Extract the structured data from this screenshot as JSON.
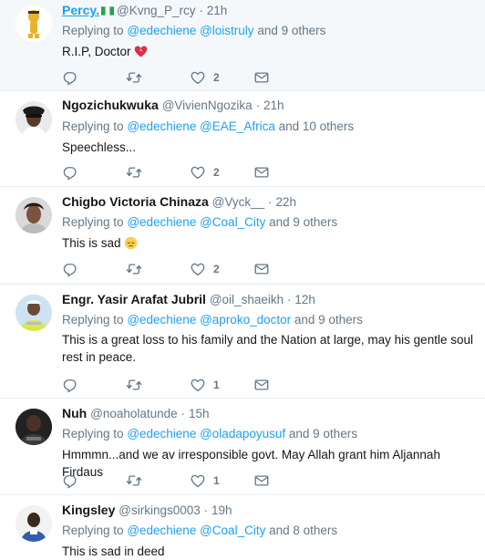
{
  "tweets": [
    {
      "name": "Percy.",
      "handle": "@Kvng_P_rcy",
      "separator": "·",
      "time": "21h",
      "replying_to_label": "Replying to",
      "mentions": [
        "@edechiene",
        "@loistruly"
      ],
      "others": "and 9 others",
      "text": "R.I.P, Doctor",
      "like_count": "2",
      "flag": "nigeria-flag",
      "emoji": "broken-heart"
    },
    {
      "name": "Ngozichukwuka",
      "handle": "@VivienNgozika",
      "separator": "·",
      "time": "21h",
      "replying_to_label": "Replying to",
      "mentions": [
        "@edechiene",
        "@EAE_Africa"
      ],
      "others": "and 10 others",
      "text": "Speechless...",
      "like_count": "2"
    },
    {
      "name": "Chigbo Victoria Chinaza",
      "handle": "@Vyck__",
      "separator": "·",
      "time": "22h",
      "replying_to_label": "Replying to",
      "mentions": [
        "@edechiene",
        "@Coal_City"
      ],
      "others": "and 9 others",
      "text": "This is sad",
      "like_count": "2",
      "emoji": "pensive-face"
    },
    {
      "name": "Engr. Yasir Arafat Jubril",
      "handle": "@oil_shaeikh",
      "separator": "·",
      "time": "12h",
      "replying_to_label": "Replying to",
      "mentions": [
        "@edechiene",
        "@aproko_doctor"
      ],
      "others": "and 9 others",
      "text": "This is a great loss to his family and the Nation at large, may his gentle soul rest in peace.",
      "like_count": "1"
    },
    {
      "name": "Nuh",
      "handle": "@noaholatunde",
      "separator": "·",
      "time": "15h",
      "replying_to_label": "Replying to",
      "mentions": [
        "@edechiene",
        "@oladapoyusuf"
      ],
      "others": "and 9 others",
      "text": "Hmmmn...and we av irresponsible govt. May Allah grant him Aljannah Firdaus",
      "like_count": "1"
    },
    {
      "name": "Kingsley",
      "handle": "@sirkings0003",
      "separator": "·",
      "time": "19h",
      "replying_to_label": "Replying to",
      "mentions": [
        "@edechiene",
        "@Coal_City"
      ],
      "others": "and 8 others",
      "text": "This is sad in deed",
      "like_count": ""
    }
  ],
  "colors": {
    "link": "#1da1f2",
    "secondary": "#657786",
    "divider": "#e6ecf0",
    "highlight_bg": "#f5f8fa"
  }
}
